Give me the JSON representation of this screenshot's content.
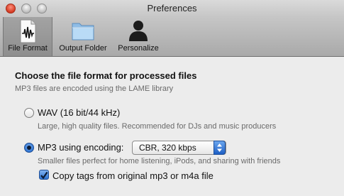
{
  "window": {
    "title": "Preferences"
  },
  "toolbar": {
    "items": [
      {
        "label": "File Format",
        "icon": "waveform-document-icon",
        "selected": true
      },
      {
        "label": "Output Folder",
        "icon": "folder-icon",
        "selected": false
      },
      {
        "label": "Personalize",
        "icon": "person-icon",
        "selected": false
      }
    ]
  },
  "main": {
    "heading": "Choose the file format for processed files",
    "subheading": "MP3 files are encoded using the LAME library",
    "options": [
      {
        "label": "WAV (16 bit/44 kHz)",
        "description": "Large, high quality files. Recommended for DJs and music producers",
        "selected": false
      },
      {
        "label": "MP3 using encoding:",
        "description": "Smaller files perfect for home listening, iPods, and sharing with friends",
        "selected": true
      }
    ],
    "encoding_select": {
      "value": "CBR, 320 kbps"
    },
    "copy_tags": {
      "label": "Copy tags from original mp3 or m4a file",
      "checked": true
    }
  },
  "colors": {
    "accent": "#2c72d1",
    "close": "#d43a22"
  }
}
